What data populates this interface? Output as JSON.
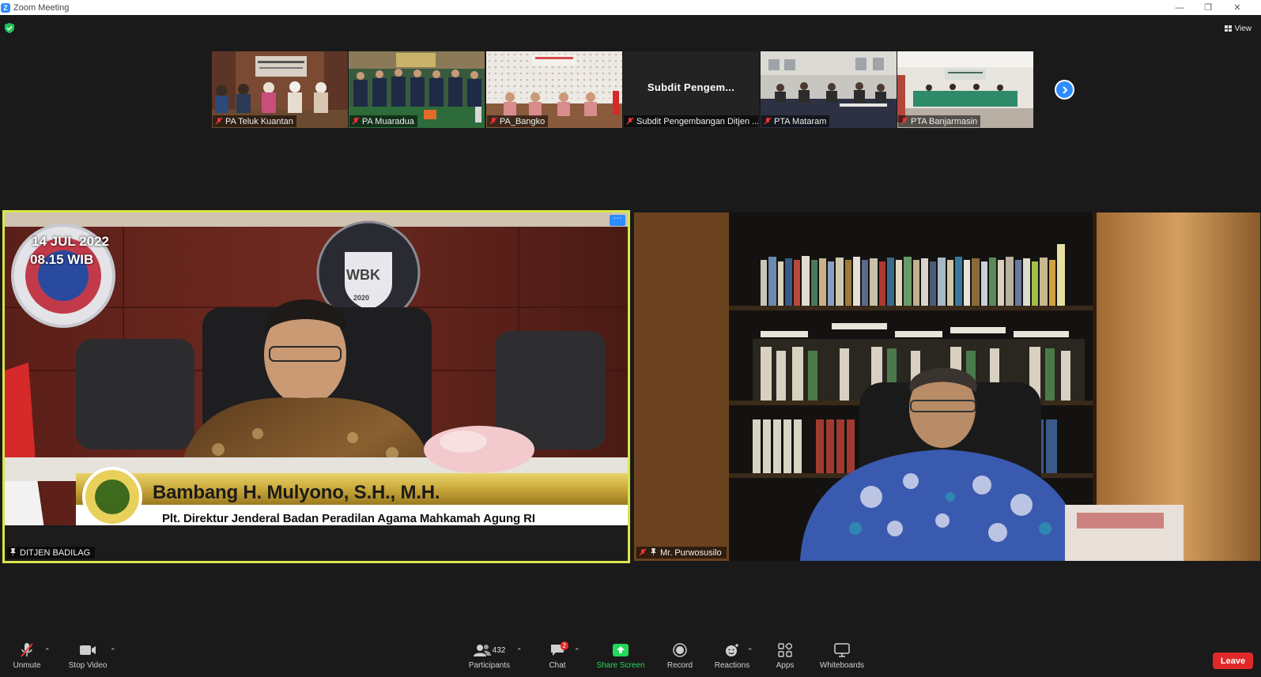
{
  "window": {
    "title": "Zoom Meeting",
    "controls": [
      "—",
      "❐",
      "✕"
    ]
  },
  "topbar": {
    "view_label": "View"
  },
  "thumbnails": [
    {
      "name": "PA Teluk Kuantan"
    },
    {
      "name": "PA Muaradua"
    },
    {
      "name": "PA_Bangko"
    },
    {
      "name": "Subdit Pengembangan Ditjen ...",
      "display_title": "Subdit   Pengem..."
    },
    {
      "name": "PTA Mataram"
    },
    {
      "name": "PTA Banjarmasin"
    }
  ],
  "main_videos": {
    "left": {
      "name": "DITJEN BADILAG",
      "caption_name": "Bambang H. Mulyono, S.H., M.H.",
      "caption_title": "Plt. Direktur Jenderal Badan Peradilan Agama Mahkamah Agung RI",
      "date_text": "14 JUL 2022",
      "time_text": "08.15 WIB",
      "badge_text": "WBK",
      "badge_year": "2020",
      "more_label": "···"
    },
    "right": {
      "name": "Mr. Purwosusilo"
    }
  },
  "toolbar": {
    "unmute": "Unmute",
    "stop_video": "Stop Video",
    "participants": "Participants",
    "participants_count": "432",
    "chat": "Chat",
    "chat_badge": "2",
    "share_screen": "Share Screen",
    "record": "Record",
    "reactions": "Reactions",
    "apps": "Apps",
    "whiteboards": "Whiteboards",
    "leave": "Leave"
  },
  "colors": {
    "accent": "#2d8cff",
    "leave": "#e02828",
    "active_speaker": "#d8e64a",
    "share_green": "#23d959"
  }
}
